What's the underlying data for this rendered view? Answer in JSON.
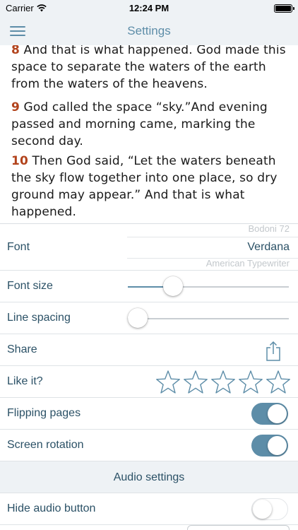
{
  "status_bar": {
    "carrier": "Carrier",
    "time": "12:24 PM"
  },
  "nav": {
    "title": "Settings",
    "menu_icon": "hamburger-icon"
  },
  "reader": {
    "verses": [
      {
        "num": "8",
        "text": " And that is what happened. God made this space to separate the waters of the earth from the waters of the heavens."
      },
      {
        "num": "9",
        "text": " God called the space “sky.”And evening passed and morning came, marking the second day."
      },
      {
        "num": "10",
        "text": " Then God said, “Let the waters beneath the sky flow together into one place, so dry ground may appear.” And that is what happened."
      }
    ],
    "verse_number_color": "#b2431c"
  },
  "settings": {
    "font": {
      "label": "Font",
      "options_visible": [
        "Bodoni 72",
        "Verdana",
        "American Typewriter"
      ],
      "selected": "Verdana"
    },
    "font_size": {
      "label": "Font size",
      "value": 0.25
    },
    "line_spacing": {
      "label": "Line spacing",
      "value": 0.0
    },
    "share": {
      "label": "Share",
      "icon": "share-icon"
    },
    "like": {
      "label": "Like it?",
      "rating": 0,
      "max": 5,
      "icon": "star-outline-icon"
    },
    "flipping_pages": {
      "label": "Flipping pages",
      "on": true
    },
    "screen_rotation": {
      "label": "Screen rotation",
      "on": true
    },
    "audio_header": "Audio settings",
    "hide_audio_button": {
      "label": "Hide audio button",
      "on": false
    }
  },
  "colors": {
    "accent": "#5d8da8",
    "text_dark": "#2b5166",
    "nav_bg": "#eef2f5"
  }
}
